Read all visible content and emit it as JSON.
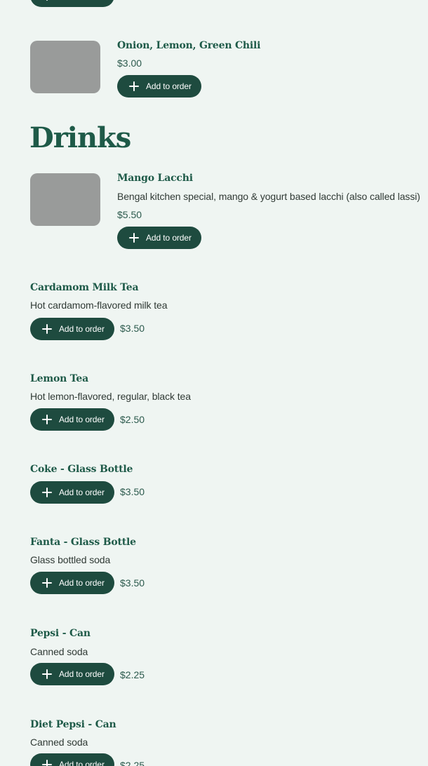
{
  "common": {
    "add_label": "Add to order"
  },
  "colors": {
    "background": "#eff5f2",
    "accent": "#1e4b3f",
    "title": "#1e5a48",
    "thumbnail_placeholder": "#999b9a"
  },
  "icons": {
    "add": "plus-icon"
  },
  "previous_item": {
    "price": "$3.00",
    "name": "Onion, Lemon, Green Chili"
  },
  "drinks": {
    "title": "Drinks",
    "items": [
      {
        "name": "Mango Lacchi",
        "description": "Bengal kitchen special, mango & yogurt based lacchi (also called lassi)",
        "price": "$5.50"
      },
      {
        "name": "Cardamom Milk Tea",
        "description": "Hot cardamom-flavored milk tea",
        "price": "$3.50"
      },
      {
        "name": "Lemon Tea",
        "description": "Hot lemon-flavored, regular, black tea",
        "price": "$2.50"
      },
      {
        "name": "Coke - Glass Bottle",
        "price": "$3.50"
      },
      {
        "name": "Fanta - Glass Bottle",
        "description": "Glass bottled soda",
        "price": "$3.50"
      },
      {
        "name": "Pepsi - Can",
        "description": "Canned soda",
        "price": "$2.25"
      },
      {
        "name": "Diet Pepsi - Can",
        "description": "Canned soda",
        "price": "$2.25"
      }
    ]
  }
}
